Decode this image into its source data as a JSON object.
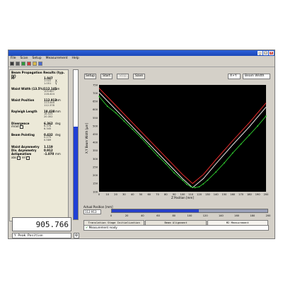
{
  "window": {
    "controls": [
      "_",
      "□",
      "×"
    ],
    "menu": [
      "File",
      "Scan",
      "Setup",
      "Measurement",
      "Help"
    ]
  },
  "left_panel": {
    "title": "Beam Propagation Results (typ. IV)",
    "m2": {
      "label": "M²",
      "value": "1.047",
      "sub1": "1.022",
      "sub2": "1.051",
      "ux": "X",
      "uy": "Y"
    },
    "waist_width": {
      "label": "Waist Width (13.5%)",
      "value": "112.145",
      "unit": "μm",
      "sub1": "105.867",
      "sub2": "118.424"
    },
    "waist_position": {
      "label": "Waist Position",
      "value": "112.913",
      "unit": "mm",
      "sub1": "113.448",
      "sub2": "112.378"
    },
    "rayleigh": {
      "label": "Rayleigh Length",
      "value": "18.438",
      "unit": "mm",
      "sub1": "16.525",
      "sub2": "20.352"
    },
    "divergence": {
      "label": "Divergence",
      "value": "6.362",
      "unit": "deg",
      "sub1": "6.378",
      "sub2": "6.345",
      "mode": "mrad"
    },
    "beam_pointing": {
      "label": "Beam Pointing",
      "value": "0.432",
      "unit": "deg",
      "sub1": "0.275",
      "sub2": "0.589"
    },
    "waist_asym": {
      "label": "Waist Asymmetry",
      "value": "1.119"
    },
    "div_asym": {
      "label": "Div. Asymmetry",
      "value": "0.912"
    },
    "astig": {
      "label": "Astigmatism",
      "value": "-1.070",
      "unit": "mm"
    },
    "abs_label": "abs",
    "rel_label": "rel"
  },
  "intensity_bar": {
    "fraction": 0.62,
    "color": "#1f3fd6"
  },
  "peak": {
    "value": "905.766",
    "selector": "Y Peak Position"
  },
  "buttons": {
    "setup": "Setup",
    "start": "Start",
    "stop": "Stop",
    "save": "Save"
  },
  "axis_selector": "X+Y",
  "plot_selector": "Beam Width",
  "chart_data": {
    "type": "line",
    "xlabel": "Z Position [mm]",
    "ylabel": "X,Y Beam Width [µm]",
    "xlim": [
      0,
      200
    ],
    "ylim": [
      100,
      750
    ],
    "x_ticks": [
      0,
      10,
      20,
      30,
      40,
      50,
      60,
      70,
      80,
      90,
      100,
      110,
      120,
      130,
      140,
      150,
      160,
      170,
      180,
      190,
      200
    ],
    "y_ticks": [
      100,
      150,
      200,
      250,
      300,
      350,
      400,
      450,
      500,
      550,
      600,
      650,
      700,
      750
    ],
    "background": "#000000",
    "series": [
      {
        "color": "#ff3030",
        "x": [
          0,
          20,
          40,
          60,
          80,
          100,
          112,
          125,
          140,
          160,
          180,
          200
        ],
        "values": [
          730,
          625,
          520,
          415,
          310,
          205,
          150,
          205,
          295,
          410,
          520,
          640
        ]
      },
      {
        "color": "#ffffff",
        "x": [
          0,
          20,
          40,
          60,
          80,
          100,
          112,
          125,
          140,
          160,
          180,
          200
        ],
        "values": [
          705,
          600,
          495,
          390,
          285,
          180,
          125,
          180,
          270,
          385,
          495,
          615
        ]
      },
      {
        "color": "#30d030",
        "x": [
          0,
          10,
          20,
          30,
          40,
          50,
          60,
          70,
          80,
          90,
          100,
          105,
          110,
          115,
          120,
          125,
          130,
          140,
          150,
          160,
          170,
          180,
          190,
          200
        ],
        "values": [
          680,
          620,
          580,
          530,
          480,
          430,
          375,
          320,
          270,
          215,
          170,
          145,
          130,
          125,
          130,
          148,
          170,
          220,
          275,
          335,
          390,
          445,
          500,
          560
        ]
      }
    ]
  },
  "position": {
    "label": "Actual Position [mm]",
    "value": "112.913",
    "fraction": 0.56,
    "scale": [
      "0",
      "20",
      "40",
      "60",
      "80",
      "100",
      "120",
      "140",
      "160",
      "180",
      "200"
    ]
  },
  "tabs": [
    "Translation Stage Initialization",
    "Beam Alignment",
    "M2 Measurement"
  ],
  "status_text": "Measurement ready"
}
